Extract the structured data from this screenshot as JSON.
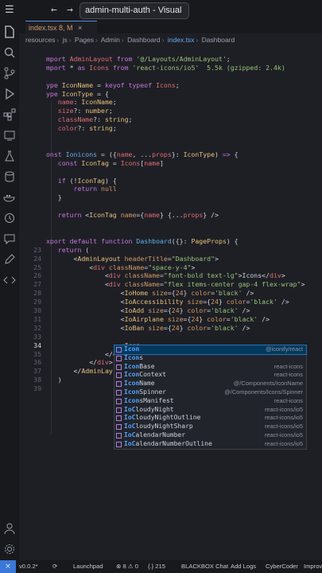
{
  "titlebar": {
    "title": "admin-multi-auth - Visual"
  },
  "tab": {
    "label": "index.tsx 8, M",
    "close": "×"
  },
  "breadcrumbs": [
    "resources",
    "js",
    "Pages",
    "Admin",
    "Dashboard",
    "index.tsx",
    "Dashboard"
  ],
  "code_lines": [
    {
      "ln": "",
      "html": ""
    },
    {
      "ln": "",
      "html": "<span class='k'>mport</span> <span class='v'>AdminLayout</span> <span class='k'>from</span> <span class='s'>'@/Layouts/AdminLayout'</span>;"
    },
    {
      "ln": "",
      "html": "<span class='k'>mport</span> * <span class='k'>as</span> <span class='v'>Icons</span> <span class='k'>from</span> <span class='s'>'react-icons/io5'</span>  <span class='s'>5.5k (gzipped: 2.4k)</span>"
    },
    {
      "ln": "",
      "html": ""
    },
    {
      "ln": "",
      "html": "<span class='k'>ype</span> <span class='t'>IconName</span> = <span class='k'>keyof</span> <span class='k'>typeof</span> <span class='v'>Icons</span>;"
    },
    {
      "ln": "",
      "html": "<span class='k'>ype</span> <span class='t'>IconType</span> = {"
    },
    {
      "ln": "",
      "html": "   <span class='v'>name</span>: <span class='t'>IconName</span>;"
    },
    {
      "ln": "",
      "html": "   <span class='v'>size</span>?: <span class='t'>number</span>;"
    },
    {
      "ln": "",
      "html": "   <span class='v'>className</span>?: <span class='t'>string</span>;"
    },
    {
      "ln": "",
      "html": "   <span class='v'>color</span>?: <span class='t'>string</span>;"
    },
    {
      "ln": "",
      "html": ""
    },
    {
      "ln": "",
      "html": ""
    },
    {
      "ln": "",
      "html": "<span class='k'>onst</span> <span class='f'>Ionicons</span> = ({<span class='v'>name</span>, ...<span class='v'>props</span>}: <span class='t'>IconType</span>) <span class='k'>=&gt;</span> {"
    },
    {
      "ln": "",
      "html": "   <span class='k'>const</span> <span class='t'>IconTag</span> = <span class='v'>Icons</span>[<span class='v'>name</span>]"
    },
    {
      "ln": "",
      "html": ""
    },
    {
      "ln": "",
      "html": "   <span class='k'>if</span> (!<span class='t'>IconTag</span>) {"
    },
    {
      "ln": "",
      "html": "       <span class='k'>return</span> <span class='n'>null</span>"
    },
    {
      "ln": "",
      "html": "   }"
    },
    {
      "ln": "",
      "html": ""
    },
    {
      "ln": "",
      "html": "   <span class='k'>return</span> &lt;<span class='t'>IconTag</span> <span class='n'>name</span>={<span class='v'>name</span>} {...<span class='v'>props</span>} /&gt;"
    },
    {
      "ln": "",
      "html": ""
    },
    {
      "ln": "",
      "html": ""
    },
    {
      "ln": "",
      "html": "<span class='k'>xport</span> <span class='k'>default</span> <span class='k'>function</span> <span class='f'>Dashboard</span>({}: <span class='t'>PageProps</span>) {"
    },
    {
      "ln": "23",
      "html": "   <span class='k'>return</span> ("
    },
    {
      "ln": "24",
      "html": "       &lt;<span class='t'>AdminLayout</span> <span class='n'>headerTitle</span>=<span class='s'>\"Dashboard\"</span>&gt;"
    },
    {
      "ln": "25",
      "html": "           &lt;<span class='v'>div</span> <span class='n'>className</span>=<span class='s'>\"space-y-4\"</span>&gt;"
    },
    {
      "ln": "26",
      "html": "               &lt;<span class='v'>div</span> <span class='n'>className</span>=<span class='s'>\"font-bold text-lg\"</span>&gt;Icons&lt;/<span class='v'>div</span>&gt;"
    },
    {
      "ln": "27",
      "html": "               &lt;<span class='v'>div</span> <span class='n'>className</span>=<span class='s'>\"flex items-center gap-4 flex-wrap\"</span>&gt;"
    },
    {
      "ln": "28",
      "html": "                   &lt;<span class='t'>IoHome</span> <span class='n'>size</span>={<span class='n'>24</span>} <span class='n'>color</span>=<span class='s'>'black'</span> /&gt;"
    },
    {
      "ln": "29",
      "html": "                   &lt;<span class='t'>IoAccessibility</span> <span class='n'>size</span>={<span class='n'>24</span>} <span class='n'>color</span>=<span class='s'>'black'</span> /&gt;"
    },
    {
      "ln": "30",
      "html": "                   &lt;<span class='t'>IoAdd</span> <span class='n'>size</span>={<span class='n'>24</span>} <span class='n'>color</span>=<span class='s'>'black'</span> /&gt;"
    },
    {
      "ln": "31",
      "html": "                   &lt;<span class='t'>IoAirplane</span> <span class='n'>size</span>={<span class='n'>24</span>} <span class='n'>color</span>=<span class='s'>'black'</span> /&gt;"
    },
    {
      "ln": "32",
      "html": "                   &lt;<span class='t'>IoBan</span> <span class='n'>size</span>={<span class='n'>24</span>} <span class='n'>color</span>=<span class='s'>'black'</span> /&gt;"
    },
    {
      "ln": "33",
      "html": ""
    },
    {
      "ln": "34",
      "html": "                   &lt;<span class='t'>Icon</span>"
    },
    {
      "ln": "35",
      "html": "               &lt;/<span class='v'>d</span>"
    },
    {
      "ln": "36",
      "html": "           &lt;/<span class='v'>div</span>&gt;"
    },
    {
      "ln": "37",
      "html": "       &lt;/<span class='t'>AdminLay</span>"
    },
    {
      "ln": "38",
      "html": "   )"
    },
    {
      "ln": "39",
      "html": ""
    }
  ],
  "autocomplete": [
    {
      "label_match": "Icon",
      "label_rest": "",
      "detail": "@iconify/react",
      "selected": true
    },
    {
      "label_match": "Icon",
      "label_rest": "s",
      "detail": ""
    },
    {
      "label_match": "Icon",
      "label_rest": "Base",
      "detail": "react-icons"
    },
    {
      "label_match": "Icon",
      "label_rest": "Context",
      "detail": "react-icons"
    },
    {
      "label_match": "Icon",
      "label_rest": "Name",
      "detail": "@/Components/IconName"
    },
    {
      "label_match": "Icon",
      "label_rest": "Spinner",
      "detail": "@/Components/Icons/Spinner"
    },
    {
      "label_match": "Icon",
      "label_rest": "sManifest",
      "detail": "react-icons"
    },
    {
      "label_match": "IoC",
      "label_rest": "loudyNight",
      "detail": "react-icons/io5"
    },
    {
      "label_match": "IoC",
      "label_rest": "loudyNightOutline",
      "detail": "react-icons/io5"
    },
    {
      "label_match": "IoC",
      "label_rest": "loudyNightSharp",
      "detail": "react-icons/io5"
    },
    {
      "label_match": "IoC",
      "label_rest": "alendarNumber",
      "detail": "react-icons/io5"
    },
    {
      "label_match": "IoC",
      "label_rest": "alendarNumberOutline",
      "detail": "react-icons/io5"
    }
  ],
  "status": {
    "remote": "⨉",
    "version": "v0.0.2*",
    "sync": "⟳",
    "launchpad": "Launchpad",
    "problems": "⊗ 8 ⚠ 0",
    "position": "{.} 215",
    "blackbox": "BLACKBOX Chat",
    "logs": "Add Logs",
    "cybercoder": "CyberCoder",
    "improve": "Improv"
  },
  "colors": {
    "accent": "#3a77d8",
    "selection": "#04395e",
    "background": "#1e1f25"
  }
}
